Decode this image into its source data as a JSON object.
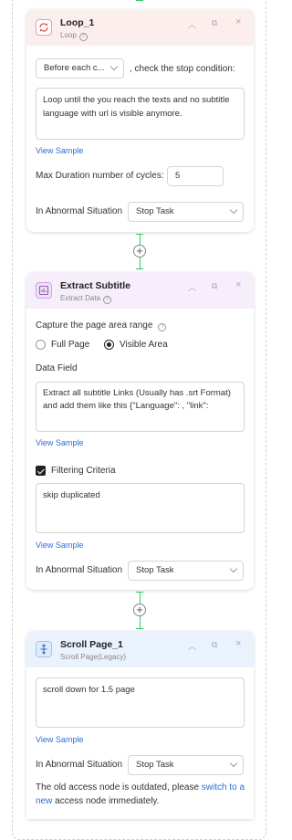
{
  "loop_card": {
    "title": "Loop_1",
    "subtitle": "Loop",
    "mode_select": "Before each c...",
    "mode_suffix": ", check the stop condition:",
    "condition_text": "Loop until the you reach the texts and no subtitle language with url is visible anymore.",
    "view_sample": "View Sample",
    "max_cycles_label": "Max Duration number of cycles:",
    "max_cycles_value": "5",
    "abnormal_label": "In Abnormal Situation",
    "abnormal_value": "Stop Task",
    "accent": "#fdeeee",
    "icon_color": "#d9534f"
  },
  "extract_card": {
    "title": "Extract Subtitle",
    "subtitle": "Extract Data",
    "capture_label": "Capture the page area range",
    "radio_full": "Full Page",
    "radio_visible": "Visible Area",
    "selected_radio": "Visible Area",
    "data_field_label": "Data Field",
    "data_field_text": "Extract all subtitle Links (Usually has .srt Format) and add them like this {\"Language\": , \"link\":",
    "view_sample_1": "View Sample",
    "filter_label": "Filtering Criteria",
    "filter_checked": true,
    "filter_text": "skip duplicated",
    "view_sample_2": "View Sample",
    "abnormal_label": "In Abnormal Situation",
    "abnormal_value": "Stop Task",
    "accent": "#f6eefb",
    "icon_color": "#9b59b6"
  },
  "scroll_card": {
    "title": "Scroll Page_1",
    "subtitle": "Scroll Page(Legacy)",
    "instruction_text": "scroll down for 1.5 page",
    "view_sample": "View Sample",
    "abnormal_label": "In Abnormal Situation",
    "abnormal_value": "Stop Task",
    "outdated_prefix": "The old access node is outdated, please ",
    "outdated_link_1": "switch to a",
    "outdated_link_2": "new",
    "outdated_suffix": " access node immediately.",
    "accent": "#eaf2fd",
    "icon_color": "#3a6fb5"
  },
  "connector_color": "#34c46a",
  "add_step_glyph": "+",
  "header_controls": {
    "collapse": "^",
    "copy": "⧉",
    "close": "×"
  }
}
